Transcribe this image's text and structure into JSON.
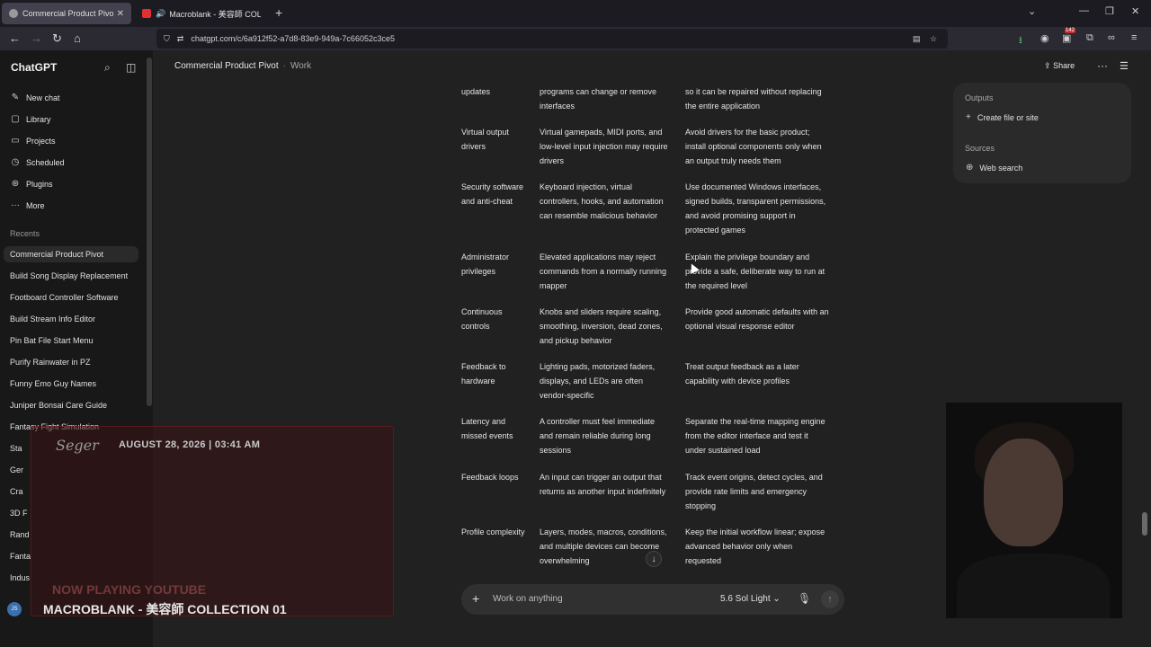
{
  "browser": {
    "tabs": [
      {
        "title": "Commercial Product Pivot",
        "active": true
      },
      {
        "title": "Macroblank - 美容師 COLLE",
        "active": false
      }
    ],
    "url": "chatgpt.com/c/6a912f52-a7d8-83e9-949a-7c66052c3ce5",
    "badge_count": "142"
  },
  "sidebar": {
    "brand": "ChatGPT",
    "nav": [
      {
        "label": "New chat",
        "icon": "edit-icon"
      },
      {
        "label": "Library",
        "icon": "library-icon"
      },
      {
        "label": "Projects",
        "icon": "folder-icon"
      },
      {
        "label": "Scheduled",
        "icon": "clock-icon"
      },
      {
        "label": "Plugins",
        "icon": "plugin-icon"
      },
      {
        "label": "More",
        "icon": "more-icon"
      }
    ],
    "recents_heading": "Recents",
    "recents": [
      "Commercial Product Pivot",
      "Build Song Display Replacement",
      "Footboard Controller Software",
      "Build Stream Info Editor",
      "Pin Bat File Start Menu",
      "Purify Rainwater in PZ",
      "Funny Emo Guy Names",
      "Juniper Bonsai Care Guide",
      "Fantasy Fight Simulation",
      "Sta",
      "Ger",
      "Cra",
      "3D F",
      "Rand",
      "Fanta",
      "Indus"
    ],
    "avatar_initials": "JS"
  },
  "overlay": {
    "date": "AUGUST 28, 2026 | 03:41 AM",
    "signature": "Seger",
    "now_playing": "NOW PLAYING YOUTUBE",
    "track": "MACROBLANK - 美容師 COLLECTION 01"
  },
  "header": {
    "title": "Commercial Product Pivot",
    "workspace": "Work",
    "share_label": "Share"
  },
  "table": {
    "rows": [
      {
        "c1": "updates",
        "c2": "programs can change or remove interfaces",
        "c3": "so it can be repaired without replacing the entire application"
      },
      {
        "c1": "Virtual output drivers",
        "c2": "Virtual gamepads, MIDI ports, and low-level input injection may require drivers",
        "c3": "Avoid drivers for the basic product; install optional components only when an output truly needs them"
      },
      {
        "c1": "Security software and anti-cheat",
        "c2": "Keyboard injection, virtual controllers, hooks, and automation can resemble malicious behavior",
        "c3": "Use documented Windows interfaces, signed builds, transparent permissions, and avoid promising support in protected games"
      },
      {
        "c1": "Administrator privileges",
        "c2": "Elevated applications may reject commands from a normally running mapper",
        "c3": "Explain the privilege boundary and provide a safe, deliberate way to run at the required level"
      },
      {
        "c1": "Continuous controls",
        "c2": "Knobs and sliders require scaling, smoothing, inversion, dead zones, and pickup behavior",
        "c3": "Provide good automatic defaults with an optional visual response editor"
      },
      {
        "c1": "Feedback to hardware",
        "c2": "Lighting pads, motorized faders, displays, and LEDs are often vendor-specific",
        "c3": "Treat output feedback as a later capability with device profiles"
      },
      {
        "c1": "Latency and missed events",
        "c2": "A controller must feel immediate and remain reliable during long sessions",
        "c3": "Separate the real-time mapping engine from the editor interface and test it under sustained load"
      },
      {
        "c1": "Feedback loops",
        "c2": "An input can trigger an output that returns as another input indefinitely",
        "c3": "Track event origins, detect cycles, and provide rate limits and emergency stopping"
      },
      {
        "c1": "Profile complexity",
        "c2": "Layers, modes, macros, conditions, and multiple devices can become overwhelming",
        "c3": "Keep the initial workflow linear; expose advanced behavior only when requested"
      }
    ]
  },
  "right_panel": {
    "outputs_heading": "Outputs",
    "create_label": "Create file or site",
    "sources_heading": "Sources",
    "web_search_label": "Web search"
  },
  "composer": {
    "placeholder": "Work on anything",
    "model_label": "5.6 Sol Light"
  }
}
